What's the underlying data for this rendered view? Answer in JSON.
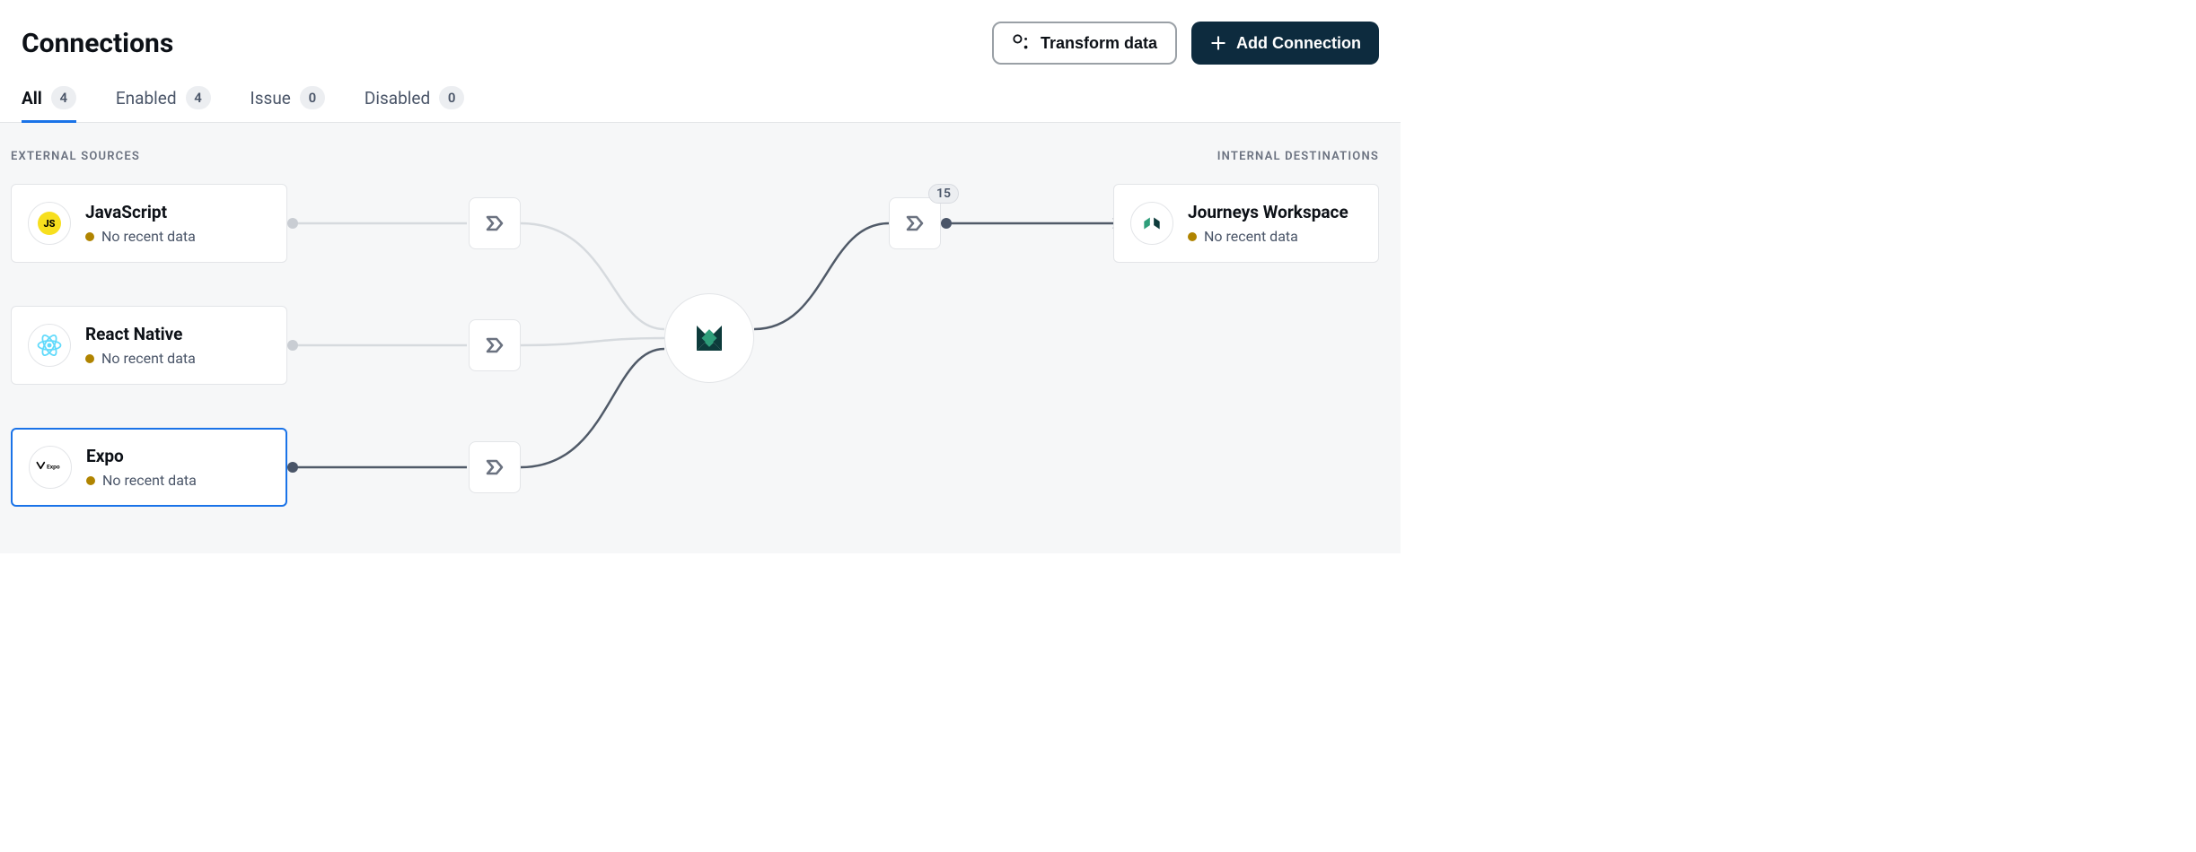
{
  "header": {
    "title": "Connections",
    "transform_label": "Transform data",
    "add_label": "Add Connection"
  },
  "tabs": [
    {
      "label": "All",
      "count": "4",
      "active": true
    },
    {
      "label": "Enabled",
      "count": "4",
      "active": false
    },
    {
      "label": "Issue",
      "count": "0",
      "active": false
    },
    {
      "label": "Disabled",
      "count": "0",
      "active": false
    }
  ],
  "sections": {
    "external_label": "EXTERNAL SOURCES",
    "internal_label": "INTERNAL DESTINATIONS"
  },
  "sources": [
    {
      "name": "JavaScript",
      "status": "No recent data",
      "icon": "js",
      "selected": false
    },
    {
      "name": "React Native",
      "status": "No recent data",
      "icon": "react",
      "selected": false
    },
    {
      "name": "Expo",
      "status": "No recent data",
      "icon": "expo",
      "selected": true
    }
  ],
  "destinations": [
    {
      "name": "Journeys Workspace",
      "status": "No recent data",
      "icon": "journeys"
    }
  ],
  "flow": {
    "destination_badge": "15"
  }
}
